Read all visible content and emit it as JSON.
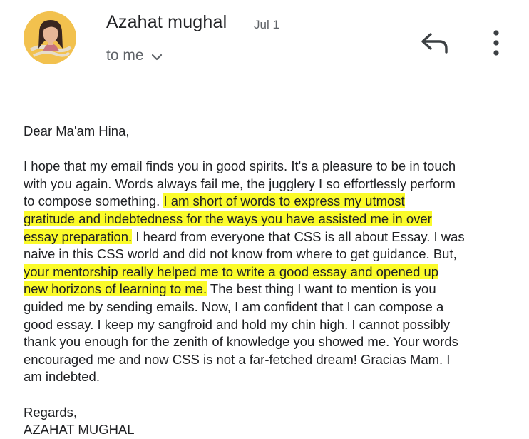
{
  "header": {
    "sender_name": "Azahat mughal",
    "date": "Jul 1",
    "recipient": "to me",
    "icons": {
      "avatar": "profile-photo",
      "expand": "chevron-down-icon",
      "reply": "reply-icon",
      "more": "more-vert-icon"
    }
  },
  "message": {
    "greeting": "Dear Ma'am Hina,",
    "lines": [
      {
        "segments": [
          {
            "text": "I hope that my email finds you in good spirits. It's a pleasure to be in touch",
            "hl": false
          }
        ]
      },
      {
        "segments": [
          {
            "text": "with you again. Words always fail me, the jugglery I so effortlessly perform",
            "hl": false
          }
        ]
      },
      {
        "segments": [
          {
            "text": "to compose something. ",
            "hl": false
          },
          {
            "text": "I am short of words to express my utmost",
            "hl": true
          }
        ]
      },
      {
        "segments": [
          {
            "text": "gratitude and indebtedness for the ways you have assisted me in over",
            "hl": true
          }
        ]
      },
      {
        "segments": [
          {
            "text": "essay preparation.",
            "hl": true
          },
          {
            "text": " I heard from everyone that CSS is all about Essay. I was",
            "hl": false
          }
        ]
      },
      {
        "segments": [
          {
            "text": "naive in this CSS world and did not know from where to get guidance. But,",
            "hl": false
          }
        ]
      },
      {
        "segments": [
          {
            "text": "your mentorship really helped me to write a good essay and opened up",
            "hl": true
          }
        ]
      },
      {
        "segments": [
          {
            "text": "new horizons of learning to me.",
            "hl": true
          },
          {
            "text": " The best thing I want to mention is you",
            "hl": false
          }
        ]
      },
      {
        "segments": [
          {
            "text": "guided me by sending emails. Now, I am confident that I can compose a",
            "hl": false
          }
        ]
      },
      {
        "segments": [
          {
            "text": "good essay.  I keep my sangfroid and hold my chin high.  I cannot possibly",
            "hl": false
          }
        ]
      },
      {
        "segments": [
          {
            "text": "thank you enough for the zenith of knowledge you showed me. Your words",
            "hl": false
          }
        ]
      },
      {
        "segments": [
          {
            "text": "encouraged me and now CSS is not a far-fetched dream! Gracias Mam. I",
            "hl": false
          }
        ]
      },
      {
        "segments": [
          {
            "text": "am indebted.",
            "hl": false
          }
        ]
      }
    ],
    "signoff": "Regards,",
    "signature": "AZAHAT MUGHAL",
    "highlight_color": "#fbfb2a"
  }
}
